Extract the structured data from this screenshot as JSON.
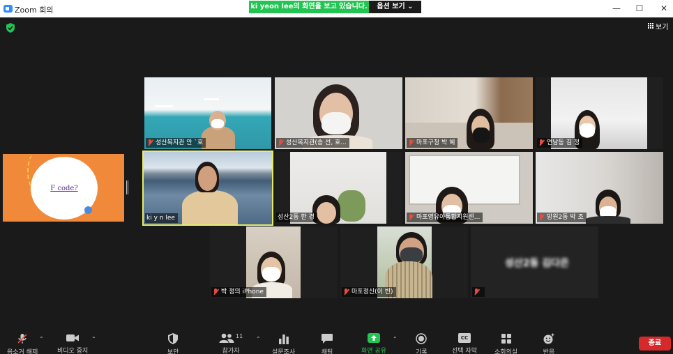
{
  "window": {
    "title": "Zoom 회의",
    "minimize": "—",
    "maximize": "☐",
    "close": "✕"
  },
  "share_banner": {
    "text": "ki yeon lee의 화면을 보고 있습니다.",
    "options_label": "옵션 보기 ⌄"
  },
  "view_button": {
    "label": "보기"
  },
  "shared_screen": {
    "text": "F code?"
  },
  "participants": [
    {
      "name": "성산복지관 안 `호",
      "muted": true
    },
    {
      "name": "성산복지관(송 선, 호...",
      "muted": true
    },
    {
      "name": "마포구청 박 혜",
      "muted": true
    },
    {
      "name": "연남동 김 정",
      "muted": true
    },
    {
      "name": "ki y n lee",
      "muted": false,
      "active_speaker": true
    },
    {
      "name": "성산2동 한 경",
      "muted": false
    },
    {
      "name": "마포영유아통합지원센...",
      "muted": true
    },
    {
      "name": "망원2동 박 조",
      "muted": true
    },
    {
      "name": "박 정의 iPhone",
      "muted": true
    },
    {
      "name": "마포정신(이 빈)",
      "muted": true
    },
    {
      "name": "",
      "muted": true,
      "video_off_name": "성산2동 김다은"
    }
  ],
  "toolbar": {
    "unmute": "음소거 해제",
    "stop_video": "비디오 중지",
    "security": "보안",
    "participants": "참가자",
    "participants_count": "11",
    "polls": "설문조사",
    "chat": "채팅",
    "share_screen": "화면 공유",
    "record": "기록",
    "captions_icon": "CC",
    "captions": "선택 자막",
    "breakout": "소회의실",
    "reactions": "반응",
    "end": "종료"
  },
  "colors": {
    "share_green": "#23c552",
    "active_speaker": "#e4ed6b",
    "end_red": "#d6292b",
    "share_bg": "#f08a3a"
  }
}
